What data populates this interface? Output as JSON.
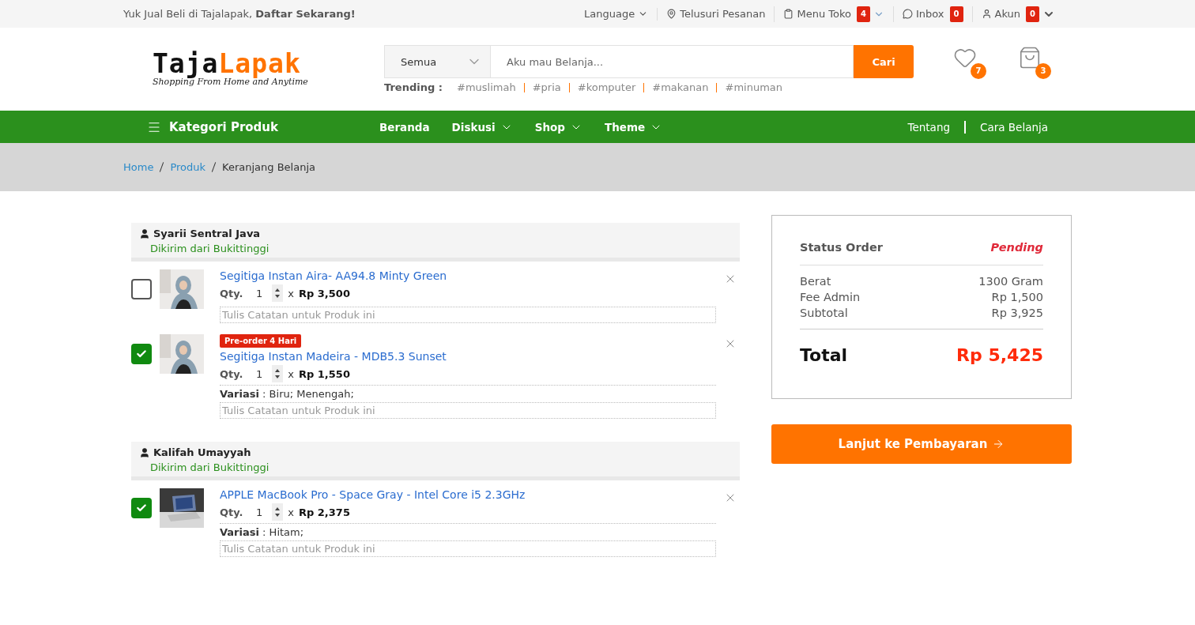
{
  "topbar": {
    "promo": "Yuk Jual Beli di Tajalapak, **Daftar Sekarang!**",
    "links": [
      {
        "kind": "language",
        "label": "Language"
      },
      {
        "kind": "track",
        "label": "Telusuri Pesanan"
      },
      {
        "kind": "shop",
        "label": "Menu Toko",
        "count": "4"
      },
      {
        "kind": "inbox",
        "label": "Inbox",
        "count": "0"
      },
      {
        "kind": "account",
        "label": "Akun",
        "count": "0"
      }
    ]
  },
  "header": {
    "logo": {
      "first": "Taja",
      "second": "Lapak",
      "tagline": "Shopping From Home and Anytime"
    },
    "search": {
      "category": "Semua",
      "placeholder": "Aku mau Belanja...",
      "button": "Cari"
    },
    "trending_label": "Trending :",
    "trending": [
      "#muslimah",
      "#pria",
      "#komputer",
      "#makanan",
      "#minuman"
    ],
    "wishlist_count": "7",
    "cart_count": "3"
  },
  "nav": {
    "category_button": "Kategori Produk",
    "items": [
      {
        "label": "Beranda",
        "dropdown": false
      },
      {
        "label": "Diskusi",
        "dropdown": true
      },
      {
        "label": "Shop",
        "dropdown": true
      },
      {
        "label": "Theme",
        "dropdown": true
      }
    ],
    "right_links": [
      "Tentang",
      "Cara Belanja"
    ]
  },
  "breadcrumb": [
    {
      "label": "Home",
      "link": true
    },
    {
      "label": "Produk",
      "link": true
    },
    {
      "label": "Keranjang Belanja",
      "link": false
    }
  ],
  "stores": [
    {
      "name": "Syarii Sentral Java",
      "origin": "Dikirim dari Bukittinggi",
      "items": [
        {
          "title": "Segitiga Instan Aira- AA94.8 Minty Green",
          "checked": false,
          "qty_label": "Qty.",
          "qty": "1",
          "times": "x",
          "price": "Rp 3,500",
          "note_placeholder": "Tulis Catatan untuk Produk ini"
        },
        {
          "title": "Segitiga Instan Madeira - MDB5.3 Sunset",
          "badge": "Pre-order 4 Hari",
          "checked": true,
          "qty_label": "Qty.",
          "qty": "1",
          "times": "x",
          "price": "Rp 1,550",
          "variation": "**Variasi** : Biru; Menengah;",
          "note_placeholder": "Tulis Catatan untuk Produk ini"
        }
      ]
    },
    {
      "name": "Kalifah Umayyah",
      "origin": "Dikirim dari Bukittinggi",
      "items": [
        {
          "title": "APPLE MacBook Pro - Space Gray - Intel Core i5 2.3GHz",
          "checked": true,
          "qty_label": "Qty.",
          "qty": "1",
          "times": "x",
          "price": "Rp 2,375",
          "variation": "**Variasi** : Hitam;",
          "note_placeholder": "Tulis Catatan untuk Produk ini"
        }
      ]
    }
  ],
  "summary": {
    "status_label": "Status Order",
    "status": "Pending",
    "rows": [
      {
        "label": "Berat",
        "value": "1300 Gram"
      },
      {
        "label": "Fee Admin",
        "value": "Rp 1,500"
      },
      {
        "label": "Subtotal",
        "value": "Rp 3,925"
      }
    ],
    "total_label": "Total",
    "total": "Rp 5,425",
    "checkout_button": "Lanjut ke Pembayaran"
  }
}
